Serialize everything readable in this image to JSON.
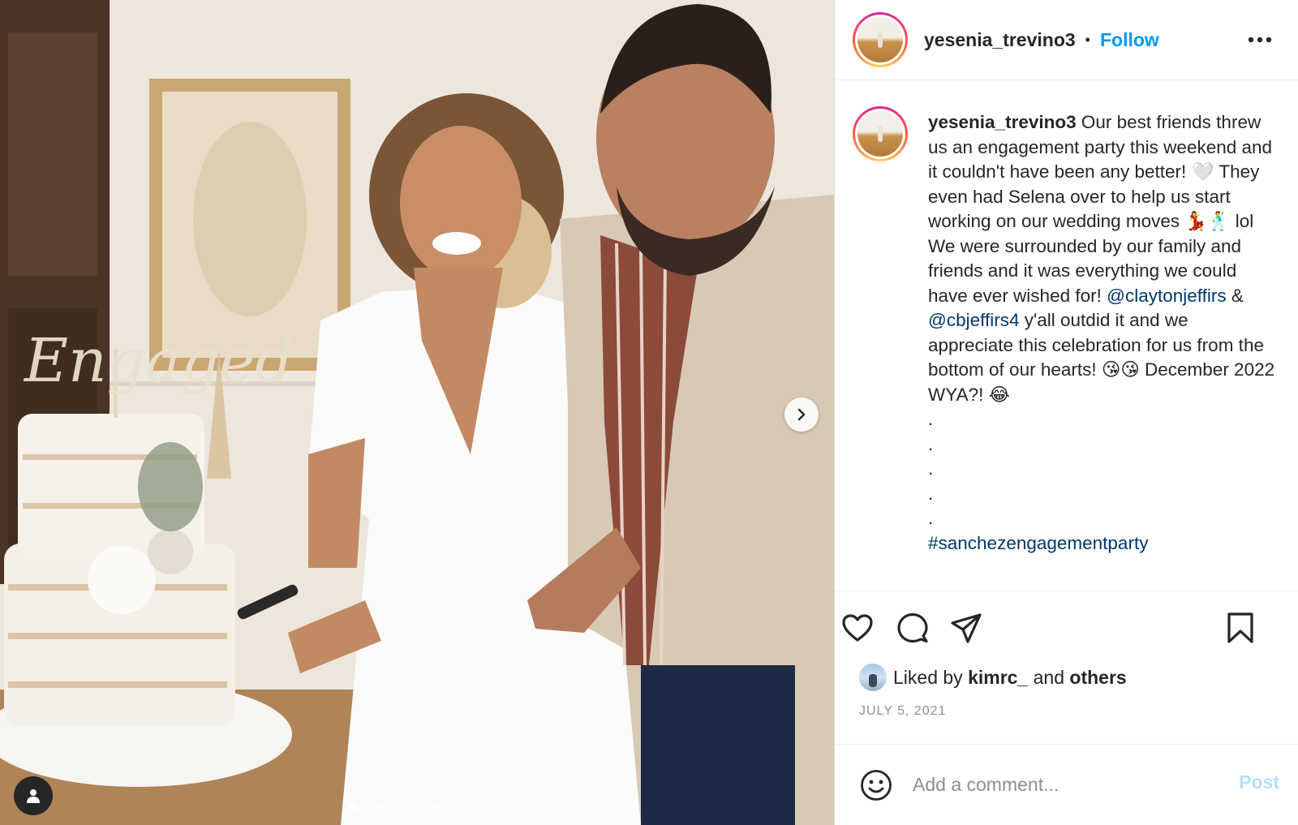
{
  "post": {
    "username": "yesenia_trevino3",
    "separator": "•",
    "follow_label": "Follow",
    "more_icon": "more-horizontal-icon",
    "photo_overlay_text": "Engaged",
    "carousel": {
      "total": 10,
      "active_index": 0
    }
  },
  "caption": {
    "username": "yesenia_trevino3",
    "part1": " Our best friends threw us an engagement party this weekend and it couldn't have been any better! 🤍 They even had Selena over to help us start working on our wedding moves 💃🕺 lol We were surrounded by our family and friends and it was everything we could have ever wished for! ",
    "mention1": "@claytonjeffirs",
    "part2": " & ",
    "mention2": "@cbjeffirs4",
    "part3": " y'all outdid it and we appreciate this celebration for us from the bottom of our hearts! 😘😘 December 2022 WYA?! 😂",
    "dot": ".",
    "hashtag": "#sanchezengagementparty"
  },
  "likes": {
    "prefix": "Liked by ",
    "user": "kimrc_",
    "middle": " and ",
    "others": "others"
  },
  "date": "JULY 5, 2021",
  "comment": {
    "placeholder": "Add a comment...",
    "post_label": "Post"
  },
  "colors": {
    "accent": "#0095f6",
    "link": "#00376b",
    "muted": "#8e8e8e",
    "post_disabled": "#b2dffc"
  }
}
